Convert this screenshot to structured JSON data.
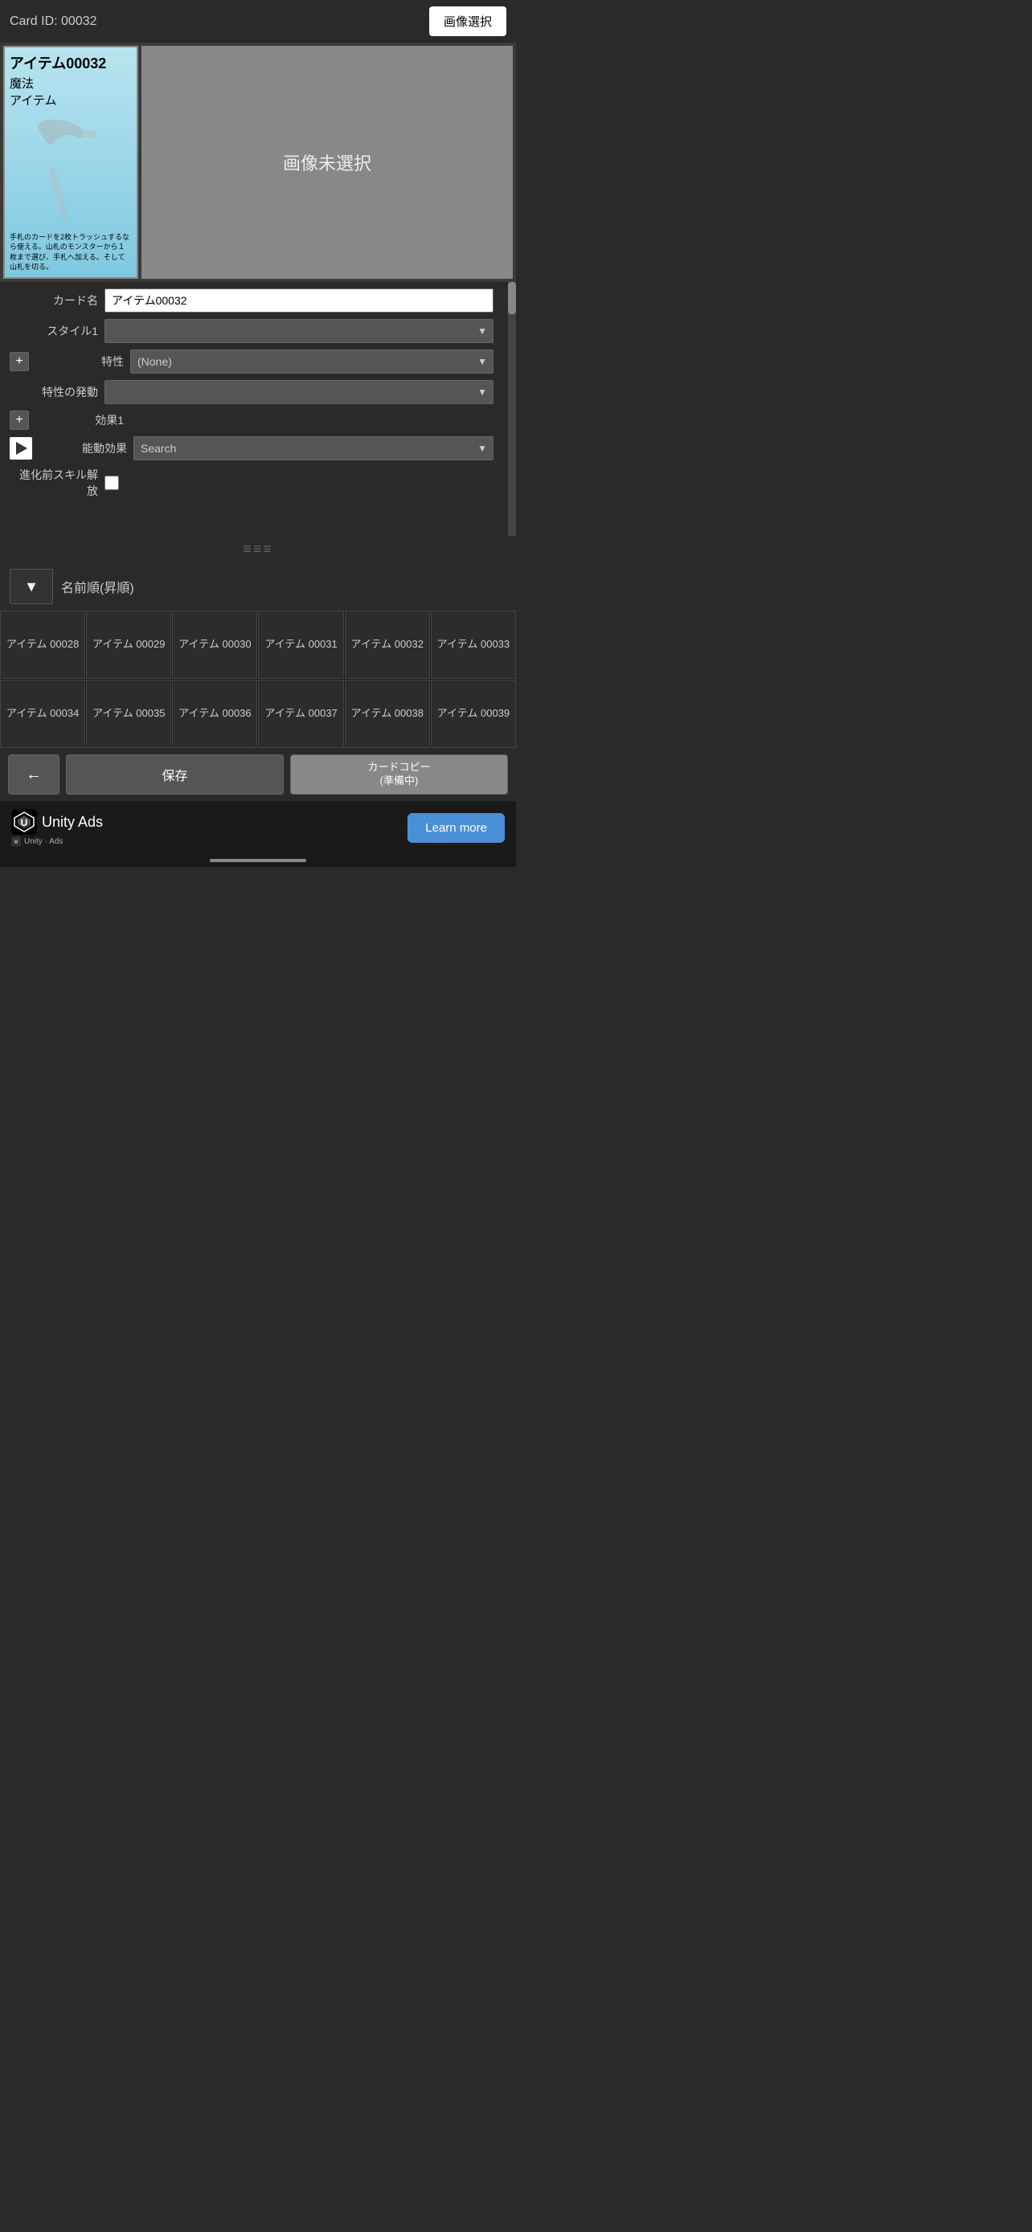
{
  "header": {
    "card_id_label": "Card ID: 00032",
    "image_select_btn": "画像選択"
  },
  "card_preview": {
    "title": "アイテム00032",
    "type1": "魔法",
    "type2": "アイテム",
    "description": "手札のカードを2枚トラッシュするなら使える。山札のモンスターから１枚まで選び、手札へ加える。そして山札を切る。",
    "no_image_text": "画像未選択"
  },
  "form": {
    "card_name_label": "カード名",
    "card_name_value": "アイテム00032",
    "style1_label": "スタイル1",
    "style1_value": "",
    "trait_label": "特性",
    "trait_value": "(None)",
    "trait_trigger_label": "特性の発動",
    "trait_trigger_value": "",
    "effect1_label": "効果1",
    "active_effect_label": "能動効果",
    "active_effect_placeholder": "Search",
    "pre_evolution_label": "進化前スキル解放"
  },
  "sort": {
    "sort_btn_icon": "▼",
    "sort_label": "名前順(昇順)"
  },
  "grid_items": [
    {
      "id": "00028",
      "label": "アイテム\n00028"
    },
    {
      "id": "00029",
      "label": "アイテム\n00029"
    },
    {
      "id": "00030",
      "label": "アイテム\n00030"
    },
    {
      "id": "00031",
      "label": "アイテム\n00031"
    },
    {
      "id": "00032",
      "label": "アイテム\n00032"
    },
    {
      "id": "00033",
      "label": "アイテム\n00033"
    },
    {
      "id": "00034",
      "label": "アイテム\n00034"
    },
    {
      "id": "00035",
      "label": "アイテム\n00035"
    },
    {
      "id": "00036",
      "label": "アイテム\n00036"
    },
    {
      "id": "00037",
      "label": "アイテム\n00037"
    },
    {
      "id": "00038",
      "label": "アイテム\n00038"
    },
    {
      "id": "00039",
      "label": "アイテム\n00039"
    }
  ],
  "bottom_bar": {
    "back_btn": "←",
    "save_btn": "保存",
    "copy_btn": "カードコピー\n(準備中)"
  },
  "ad": {
    "brand": "Unity Ads",
    "sub_label": "Unity · Ads",
    "learn_more": "Learn more"
  }
}
